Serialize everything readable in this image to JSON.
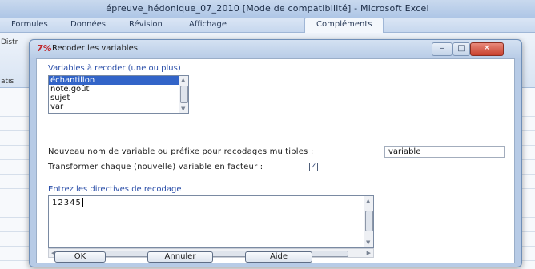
{
  "excel": {
    "title": "épreuve_hédonique_07_2010  [Mode de compatibilité]  -  Microsoft Excel",
    "tabs": [
      "Formules",
      "Données",
      "Révision",
      "Affichage",
      "Compléments"
    ],
    "active_tab": "Compléments",
    "left_strip": [
      "Distr",
      "atis"
    ]
  },
  "dialog": {
    "logo": "7%",
    "title": "Recoder les variables",
    "variables_label": "Variables à recoder (une ou plus)",
    "variables": [
      "échantillon",
      "note.goût",
      "sujet",
      "var"
    ],
    "selected_variable": "échantillon",
    "new_name_label": "Nouveau nom de variable ou préfixe pour recodages multiples :",
    "new_name_value": "variable",
    "factor_label": "Transformer chaque (nouvelle) variable en facteur :",
    "factor_checked": true,
    "directives_label": "Entrez les directives de recodage",
    "directives_value": "12345",
    "ok_label": "OK",
    "cancel_label": "Annuler",
    "help_label": "Aide"
  }
}
